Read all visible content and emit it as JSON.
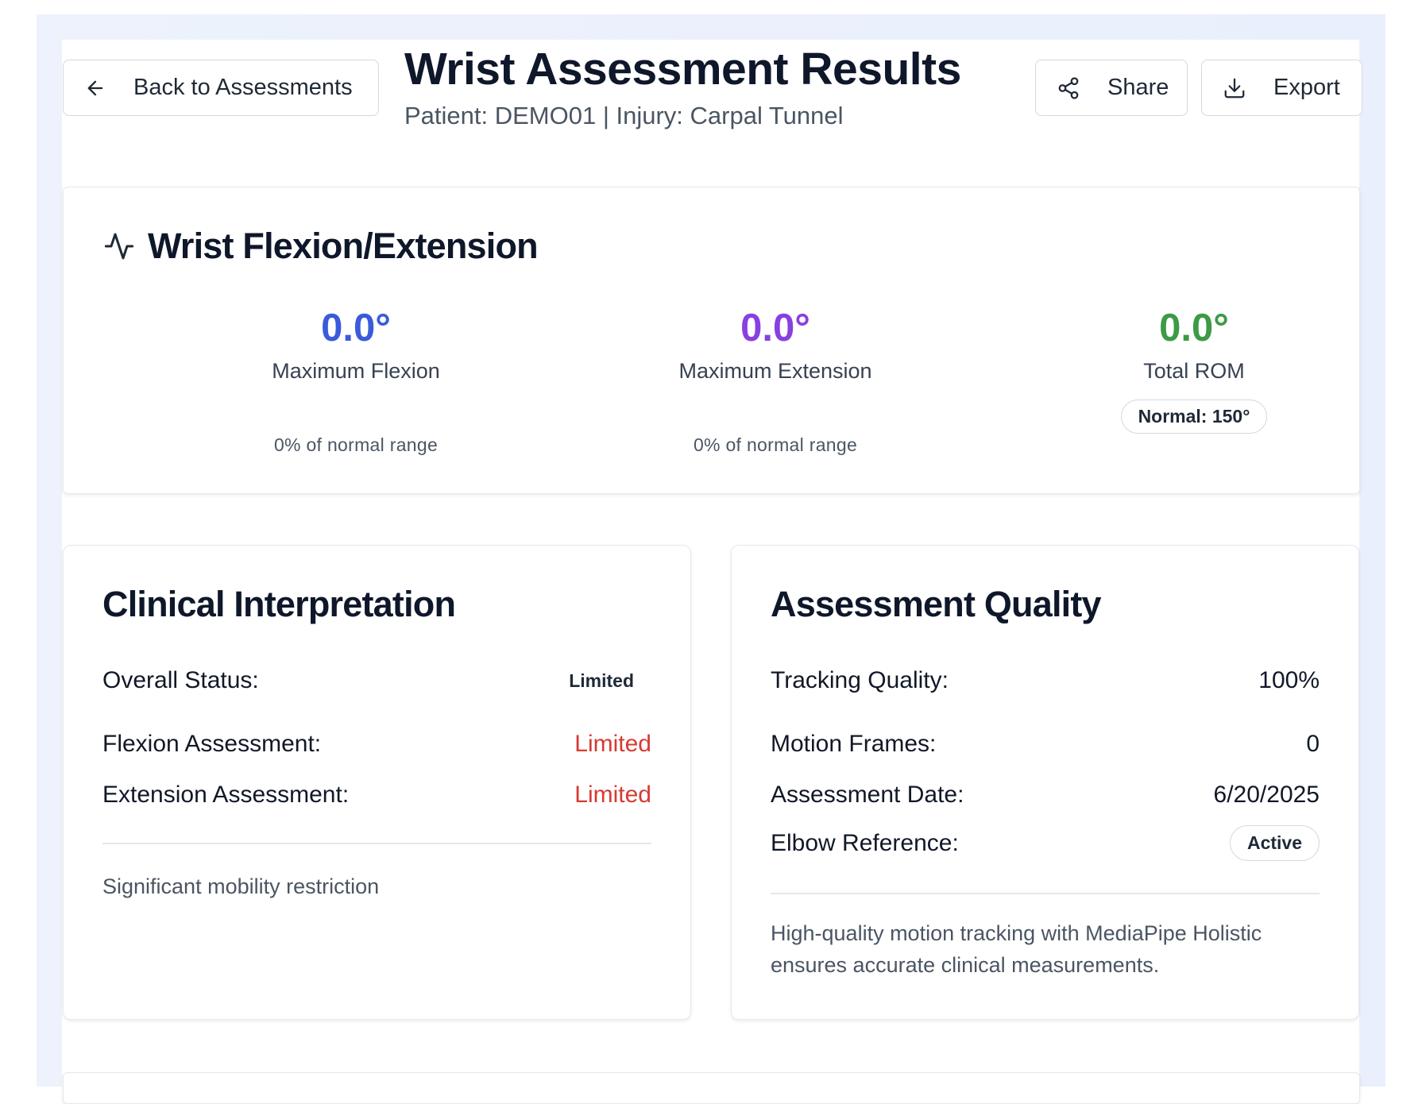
{
  "header": {
    "back_label": "Back to Assessments",
    "title": "Wrist Assessment Results",
    "subtitle": "Patient: DEMO01 | Injury: Carpal Tunnel",
    "share_label": "Share",
    "export_label": "Export"
  },
  "rom_card": {
    "title": "Wrist Flexion/Extension",
    "flexion": {
      "value": "0.0°",
      "label": "Maximum Flexion",
      "percent": "0% of normal range",
      "color": "#3b5bdb"
    },
    "extension": {
      "value": "0.0°",
      "label": "Maximum Extension",
      "percent": "0% of normal range",
      "color": "#8a3fe0"
    },
    "total": {
      "value": "0.0°",
      "label": "Total ROM",
      "badge": "Normal: 150°",
      "color": "#3d9a45"
    }
  },
  "clinical": {
    "title": "Clinical Interpretation",
    "rows": [
      {
        "key": "Overall Status:",
        "value": "Limited"
      },
      {
        "key": "Flexion Assessment:",
        "value": "Limited"
      },
      {
        "key": "Extension Assessment:",
        "value": "Limited"
      }
    ],
    "note": "Significant mobility restriction"
  },
  "quality": {
    "title": "Assessment Quality",
    "rows": [
      {
        "key": "Tracking Quality:",
        "value": "100%"
      },
      {
        "key": "Motion Frames:",
        "value": "0"
      },
      {
        "key": "Assessment Date:",
        "value": "6/20/2025"
      },
      {
        "key": "Elbow Reference:",
        "value": "Active"
      }
    ],
    "note": "High-quality motion tracking with MediaPipe Holistic ensures accurate clinical measurements."
  },
  "icons": {
    "back": "arrow-left-icon",
    "share": "share-icon",
    "export": "download-icon",
    "activity": "activity-icon"
  }
}
